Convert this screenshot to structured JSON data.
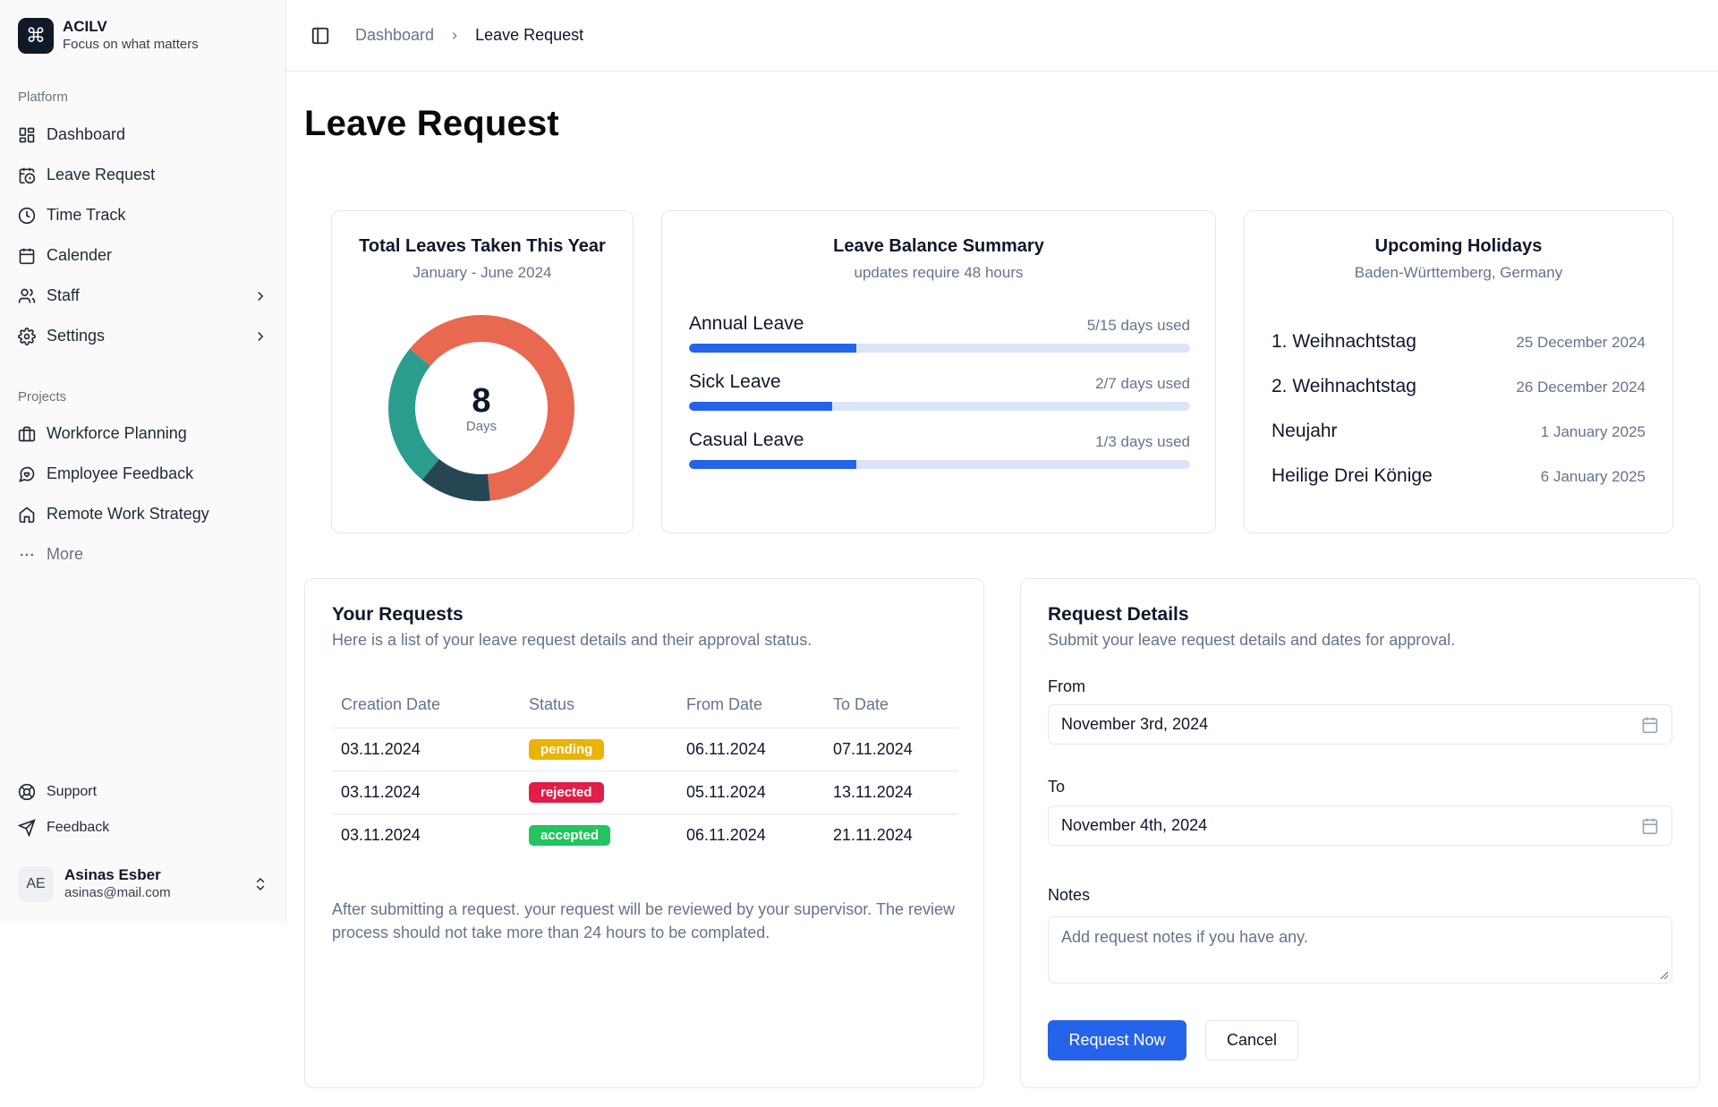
{
  "brand": {
    "name": "ACILV",
    "tagline": "Focus on what matters",
    "logo_icon": "command-icon"
  },
  "sidebar": {
    "platform_label": "Platform",
    "platform_items": [
      {
        "label": "Dashboard",
        "icon": "dashboard-icon"
      },
      {
        "label": "Leave Request",
        "icon": "calendar-clock-icon"
      },
      {
        "label": "Time Track",
        "icon": "clock-icon"
      },
      {
        "label": "Calender",
        "icon": "calendar-icon"
      },
      {
        "label": "Staff",
        "icon": "users-icon"
      },
      {
        "label": "Settings",
        "icon": "gear-icon"
      }
    ],
    "projects_label": "Projects",
    "project_items": [
      {
        "label": "Workforce Planning",
        "icon": "briefcase-icon"
      },
      {
        "label": "Employee Feedback",
        "icon": "message-icon"
      },
      {
        "label": "Remote Work Strategy",
        "icon": "home-icon"
      },
      {
        "label": "More",
        "icon": "more-icon"
      }
    ],
    "footer_items": [
      {
        "label": "Support",
        "icon": "lifebuoy-icon"
      },
      {
        "label": "Feedback",
        "icon": "send-icon"
      }
    ],
    "user": {
      "initials": "AE",
      "name": "Asinas Esber",
      "email": "asinas@mail.com"
    }
  },
  "header": {
    "breadcrumb_root": "Dashboard",
    "breadcrumb_current": "Leave Request"
  },
  "page": {
    "title": "Leave Request"
  },
  "leaves_card": {
    "title": "Total Leaves Taken This Year",
    "subtitle": "January - June 2024",
    "total": "8",
    "unit": "Days"
  },
  "chart_data": {
    "type": "pie",
    "title": "Total Leaves Taken This Year",
    "center_value": 8,
    "center_label": "Days",
    "categories": [
      "Annual Leave",
      "Sick Leave",
      "Casual Leave"
    ],
    "values": [
      5,
      2,
      1
    ],
    "colors": [
      "#e8694f",
      "#2a9d8f",
      "#264653"
    ]
  },
  "balance_card": {
    "title": "Leave Balance Summary",
    "subtitle": "updates require 48 hours",
    "rows": [
      {
        "name": "Annual Leave",
        "used_text": "5/15 days used",
        "fraction": 0.3333
      },
      {
        "name": "Sick Leave",
        "used_text": "2/7 days used",
        "fraction": 0.2857
      },
      {
        "name": "Casual Leave",
        "used_text": "1/3 days used",
        "fraction": 0.3333
      }
    ]
  },
  "holidays_card": {
    "title": "Upcoming Holidays",
    "subtitle": "Baden-Württemberg, Germany",
    "items": [
      {
        "name": "1. Weihnachtstag",
        "date": "25 December 2024"
      },
      {
        "name": "2. Weihnachtstag",
        "date": "26 December 2024"
      },
      {
        "name": "Neujahr",
        "date": "1 January 2025"
      },
      {
        "name": "Heilige Drei Könige",
        "date": "6 January 2025"
      }
    ]
  },
  "requests": {
    "title": "Your Requests",
    "subtitle": "Here is a list of your leave request details and their approval status.",
    "columns": [
      "Creation Date",
      "Status",
      "From Date",
      "To Date"
    ],
    "rows": [
      {
        "created": "03.11.2024",
        "status": "pending",
        "status_color": "#eab308",
        "from": "06.11.2024",
        "to": "07.11.2024"
      },
      {
        "created": "03.11.2024",
        "status": "rejected",
        "status_color": "#e11d48",
        "from": "05.11.2024",
        "to": "13.11.2024"
      },
      {
        "created": "03.11.2024",
        "status": "accepted",
        "status_color": "#22c55e",
        "from": "06.11.2024",
        "to": "21.11.2024"
      }
    ],
    "note": "After submitting a request. your request will be reviewed by your supervisor. The review process should not take more than 24 hours to be complated."
  },
  "request_form": {
    "title": "Request Details",
    "subtitle": "Submit your leave request details and dates for approval.",
    "from_label": "From",
    "from_value": "November 3rd, 2024",
    "to_label": "To",
    "to_value": "November 4th, 2024",
    "notes_label": "Notes",
    "notes_placeholder": "Add request notes if you have any.",
    "submit_label": "Request Now",
    "cancel_label": "Cancel"
  },
  "colors": {
    "accent": "#2563eb",
    "bar_track": "#dbe3f6"
  }
}
